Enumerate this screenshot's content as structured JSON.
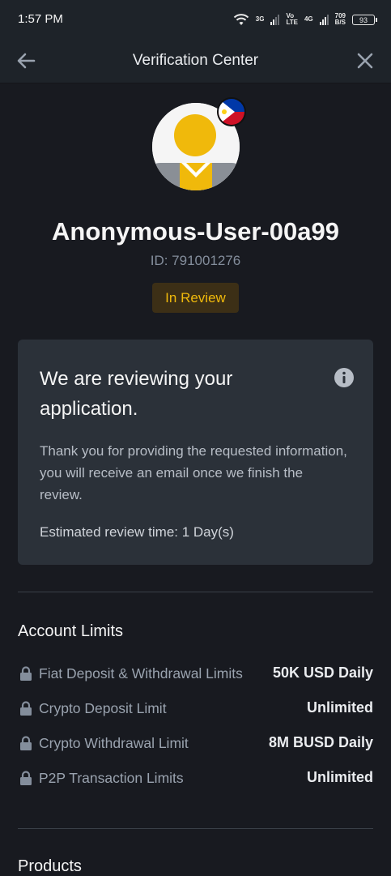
{
  "status_bar": {
    "time": "1:57 PM",
    "net1": "3G",
    "net2_top": "Vo",
    "net2_bottom": "LTE",
    "net3": "4G",
    "speed_top": "709",
    "speed_bottom": "B/S",
    "battery": "93"
  },
  "header": {
    "title": "Verification Center",
    "back_icon": "arrow-left-icon",
    "close_icon": "close-icon"
  },
  "profile": {
    "username": "Anonymous-User-00a99",
    "id_text": "ID: 791001276",
    "status_badge": "In Review",
    "flag": "philippines-flag"
  },
  "review_card": {
    "heading": "We are reviewing your application.",
    "description": "Thank you for providing the requested information, you will receive an email once we finish the review.",
    "estimate": "Estimated review time: 1 Day(s)"
  },
  "account_limits": {
    "title": "Account Limits",
    "rows": [
      {
        "label": "Fiat Deposit & Withdrawal Limits",
        "value": "50K USD Daily"
      },
      {
        "label": "Crypto Deposit Limit",
        "value": "Unlimited"
      },
      {
        "label": "Crypto Withdrawal Limit",
        "value": "8M BUSD Daily"
      },
      {
        "label": "P2P Transaction Limits",
        "value": "Unlimited"
      }
    ]
  },
  "products": {
    "title": "Products"
  },
  "colors": {
    "background": "#181a20",
    "card": "#2b3139",
    "accent": "#f0b90b",
    "badge_bg": "#3c2f16"
  }
}
